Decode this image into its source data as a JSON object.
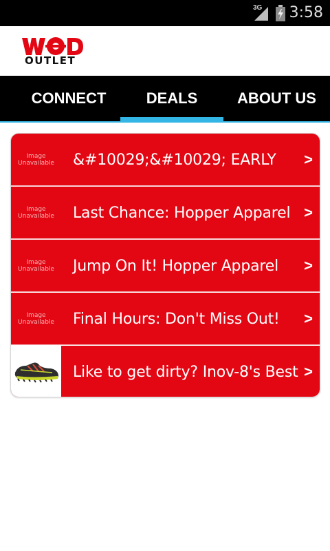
{
  "status": {
    "time": "3:58",
    "network": "3G",
    "icons": [
      "signal-icon",
      "battery-icon"
    ]
  },
  "app": {
    "logo_text_top": "WOD",
    "logo_text_bottom": "OUTLET",
    "brand_color": "#e30613"
  },
  "tabs": [
    {
      "label": "CONNECT",
      "selected": false
    },
    {
      "label": "DEALS",
      "selected": true
    },
    {
      "label": "ABOUT US",
      "selected": false
    }
  ],
  "accent_color": "#33b5e5",
  "deals": [
    {
      "title": "&#10029;&#10029; EARLY",
      "thumb": "Image Unavailable",
      "thumb_line1": "Image",
      "thumb_line2": "Unavailable",
      "arrow": ">"
    },
    {
      "title": "Last Chance: Hopper Apparel",
      "thumb": "Image Unavailable",
      "thumb_line1": "Image",
      "thumb_line2": "Unavailable",
      "arrow": ">"
    },
    {
      "title": "Jump On It! Hopper Apparel",
      "thumb": "Image Unavailable",
      "thumb_line1": "Image",
      "thumb_line2": "Unavailable",
      "arrow": ">"
    },
    {
      "title": "Final Hours: Don't Miss Out!",
      "thumb": "Image Unavailable",
      "thumb_line1": "Image",
      "thumb_line2": "Unavailable",
      "arrow": ">"
    },
    {
      "title": "Like to get dirty? Inov-8's Best",
      "thumb": "shoe-image",
      "arrow": ">"
    }
  ]
}
